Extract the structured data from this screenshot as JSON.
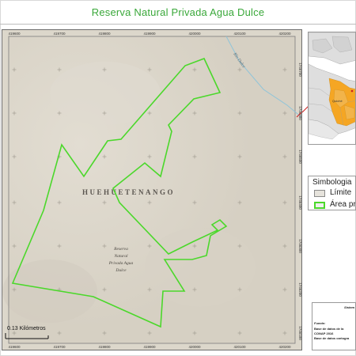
{
  "title": "Reserva Natural Privada Agua Dulce",
  "map": {
    "x_ticks": [
      "419600",
      "419700",
      "419800",
      "419900",
      "420000",
      "420100",
      "420200"
    ],
    "y_ticks": [
      "1746700",
      "1746600",
      "1746500",
      "1746400",
      "1746300",
      "1746200",
      "1746100"
    ],
    "region_label": "HUEHUETENANGO",
    "reserve_label": [
      "Reserva",
      "Natural",
      "Privada Agua",
      "Dulce"
    ],
    "river_label": "Río Dulce",
    "scale_label": "0.13 Kilómetros",
    "colors": {
      "background": "#dcd7cb",
      "boundary": "#4bd82b",
      "river": "#8fc4d9",
      "pointer": "#cc1e1e"
    }
  },
  "inset": {
    "labels": [
      "Quiché"
    ],
    "colors": {
      "sea": "#ffffff",
      "country": "#dedede",
      "highlight": "#f5a623"
    }
  },
  "legend": {
    "title": "Simbologia",
    "items": [
      {
        "label": "Límite",
        "swatch": "limit"
      },
      {
        "label": "Área pr",
        "swatch": "area"
      }
    ]
  },
  "info": {
    "system": "Sistem",
    "source_title": "Fuente:",
    "source_lines": [
      "Base de datos de la",
      "CONAP 2016",
      "Base de datos cartogra"
    ]
  }
}
